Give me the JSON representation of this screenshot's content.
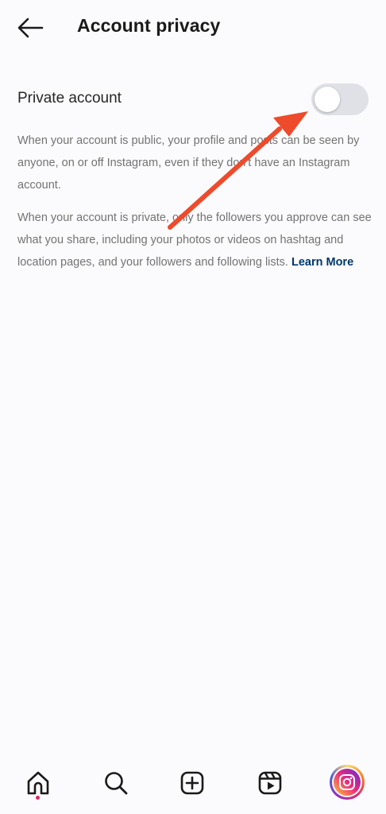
{
  "header": {
    "title": "Account privacy",
    "back_icon": "arrow-left-icon"
  },
  "settings": {
    "private_account": {
      "label": "Private account",
      "enabled": false
    }
  },
  "descriptions": {
    "public_text": "When your account is public, your profile and posts can be seen by anyone, on or off Instagram, even if they don't have an Instagram account.",
    "private_text": "When your account is private, only the followers you approve can see what you share, including your photos or videos on hashtag and location pages, and your followers and following lists.",
    "learn_more": "Learn More"
  },
  "annotation": {
    "arrow_color": "#ee4a2c",
    "arrow_icon": "red-arrow-icon"
  },
  "bottom_nav": {
    "items": [
      {
        "icon": "home-icon",
        "active": true,
        "has_notification": true
      },
      {
        "icon": "search-icon"
      },
      {
        "icon": "create-post-icon"
      },
      {
        "icon": "reels-icon"
      },
      {
        "icon": "profile-avatar-icon"
      }
    ]
  },
  "colors": {
    "background": "#fbfbfd",
    "text_primary": "#262626",
    "text_secondary": "#737373",
    "link": "#00376b",
    "toggle_off": "#dfe1e6",
    "notification": "#e0245e"
  }
}
